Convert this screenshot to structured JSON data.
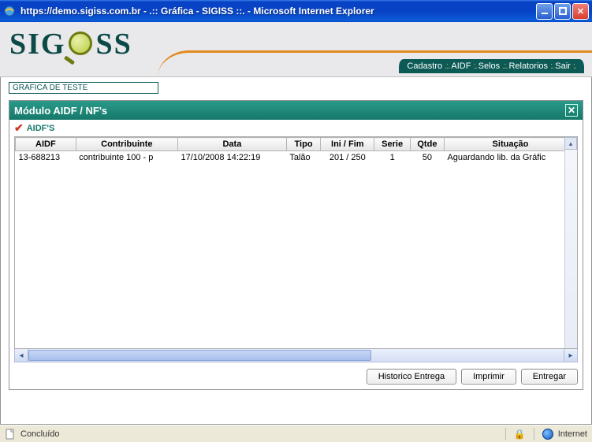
{
  "window": {
    "title": "https://demo.sigiss.com.br - .:: Gráfica - SIGISS ::. - Microsoft Internet Explorer"
  },
  "logo": {
    "text_1": "SIG",
    "text_2": "SS"
  },
  "menu": {
    "items": [
      {
        "label": "Cadastro"
      },
      {
        "label": "AIDF"
      },
      {
        "label": "Selos"
      },
      {
        "label": "Relatorios"
      },
      {
        "label": "Sair"
      }
    ]
  },
  "top_label": "GRAFICA DE TESTE",
  "module": {
    "title": "Módulo AIDF / NF's",
    "section": "AIDF'S"
  },
  "table": {
    "headers": [
      "AIDF",
      "Contribuinte",
      "Data",
      "Tipo",
      "Ini / Fim",
      "Serie",
      "Qtde",
      "Situação"
    ],
    "rows": [
      {
        "aidf": "13-688213",
        "contribuinte": "contribuinte 100 - p",
        "data": "17/10/2008 14:22:19",
        "tipo": "Talão",
        "ini_fim": "201 / 250",
        "serie": "1",
        "qtde": "50",
        "situacao": "Aguardando lib. da Gráfic"
      }
    ]
  },
  "buttons": {
    "historico": "Historico Entrega",
    "imprimir": "Imprimir",
    "entregar": "Entregar"
  },
  "status": {
    "left": "Concluído",
    "zone": "Internet"
  }
}
